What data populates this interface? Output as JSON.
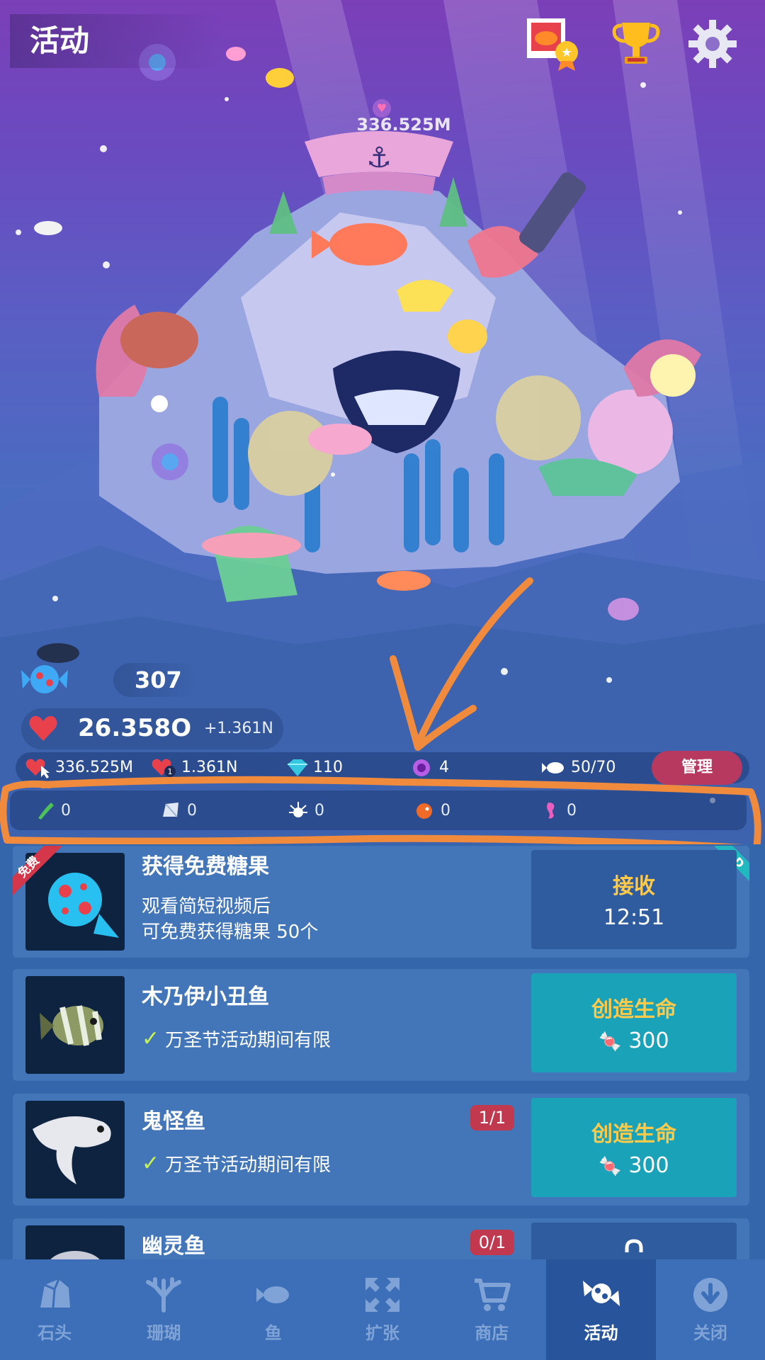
{
  "header": {
    "activity_label": "活动",
    "aquarium_value": "336.525M"
  },
  "stats": {
    "candy_count": "307",
    "love_value": "26.358O",
    "love_rate": "+1.361N",
    "tap_value": "336.525M",
    "per_sec_value": "1.361N",
    "gems": "110",
    "pearls": "4",
    "fish_count": "50/70",
    "manage_label": "管理"
  },
  "resources": [
    {
      "icon": "seaweed-icon",
      "value": "0"
    },
    {
      "icon": "shell-icon",
      "value": "0"
    },
    {
      "icon": "sea-urchin-icon",
      "value": "0"
    },
    {
      "icon": "pufferfish-icon",
      "value": "0"
    },
    {
      "icon": "seahorse-icon",
      "value": "0"
    }
  ],
  "cards": [
    {
      "title": "获得免费糖果",
      "desc_line1": "观看简短视频后",
      "desc_line2": "可免费获得糖果 50个",
      "action_label": "接收",
      "action_sub": "12:51",
      "corner_left": "免费",
      "corner_right": "AD"
    },
    {
      "title": "木乃伊小丑鱼",
      "note": "万圣节活动期间有限",
      "action_label": "创造生命",
      "action_cost": "300"
    },
    {
      "title": "鬼怪鱼",
      "badge": "1/1",
      "note": "万圣节活动期间有限",
      "action_label": "创造生命",
      "action_cost": "300"
    },
    {
      "title": "幽灵鱼",
      "badge": "0/1"
    }
  ],
  "nav": [
    {
      "label": "石头",
      "icon": "stone-icon"
    },
    {
      "label": "珊瑚",
      "icon": "coral-icon"
    },
    {
      "label": "鱼",
      "icon": "fish-icon"
    },
    {
      "label": "扩张",
      "icon": "expand-icon"
    },
    {
      "label": "商店",
      "icon": "cart-icon"
    },
    {
      "label": "活动",
      "icon": "candy-icon",
      "active": true
    },
    {
      "label": "关闭",
      "icon": "close-down-icon"
    }
  ],
  "colors": {
    "accent_gold": "#ffc94a",
    "create_button": "#1aa3b8",
    "badge_red": "#c0394f",
    "annotation_orange": "#f08a3c"
  }
}
